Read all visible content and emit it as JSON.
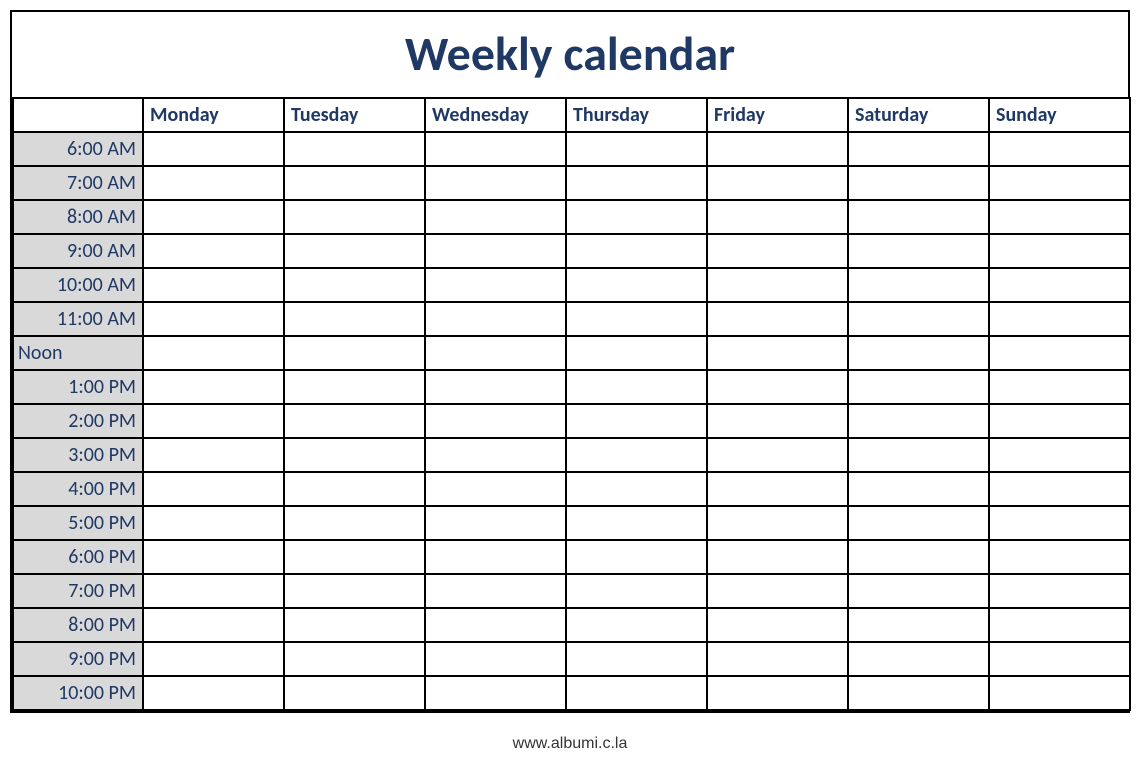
{
  "title": "Weekly calendar",
  "days": [
    "Monday",
    "Tuesday",
    "Wednesday",
    "Thursday",
    "Friday",
    "Saturday",
    "Sunday"
  ],
  "times": [
    {
      "label": "6:00 AM",
      "align": "right"
    },
    {
      "label": "7:00 AM",
      "align": "right"
    },
    {
      "label": "8:00 AM",
      "align": "right"
    },
    {
      "label": "9:00 AM",
      "align": "right"
    },
    {
      "label": "10:00 AM",
      "align": "right"
    },
    {
      "label": "11:00 AM",
      "align": "right"
    },
    {
      "label": "Noon",
      "align": "left"
    },
    {
      "label": "1:00 PM",
      "align": "right"
    },
    {
      "label": "2:00 PM",
      "align": "right"
    },
    {
      "label": "3:00 PM",
      "align": "right"
    },
    {
      "label": "4:00 PM",
      "align": "right"
    },
    {
      "label": "5:00 PM",
      "align": "right"
    },
    {
      "label": "6:00 PM",
      "align": "right"
    },
    {
      "label": "7:00 PM",
      "align": "right"
    },
    {
      "label": "8:00 PM",
      "align": "right"
    },
    {
      "label": "9:00 PM",
      "align": "right"
    },
    {
      "label": "10:00 PM",
      "align": "right"
    }
  ],
  "footer": "www.albumi.c.la"
}
